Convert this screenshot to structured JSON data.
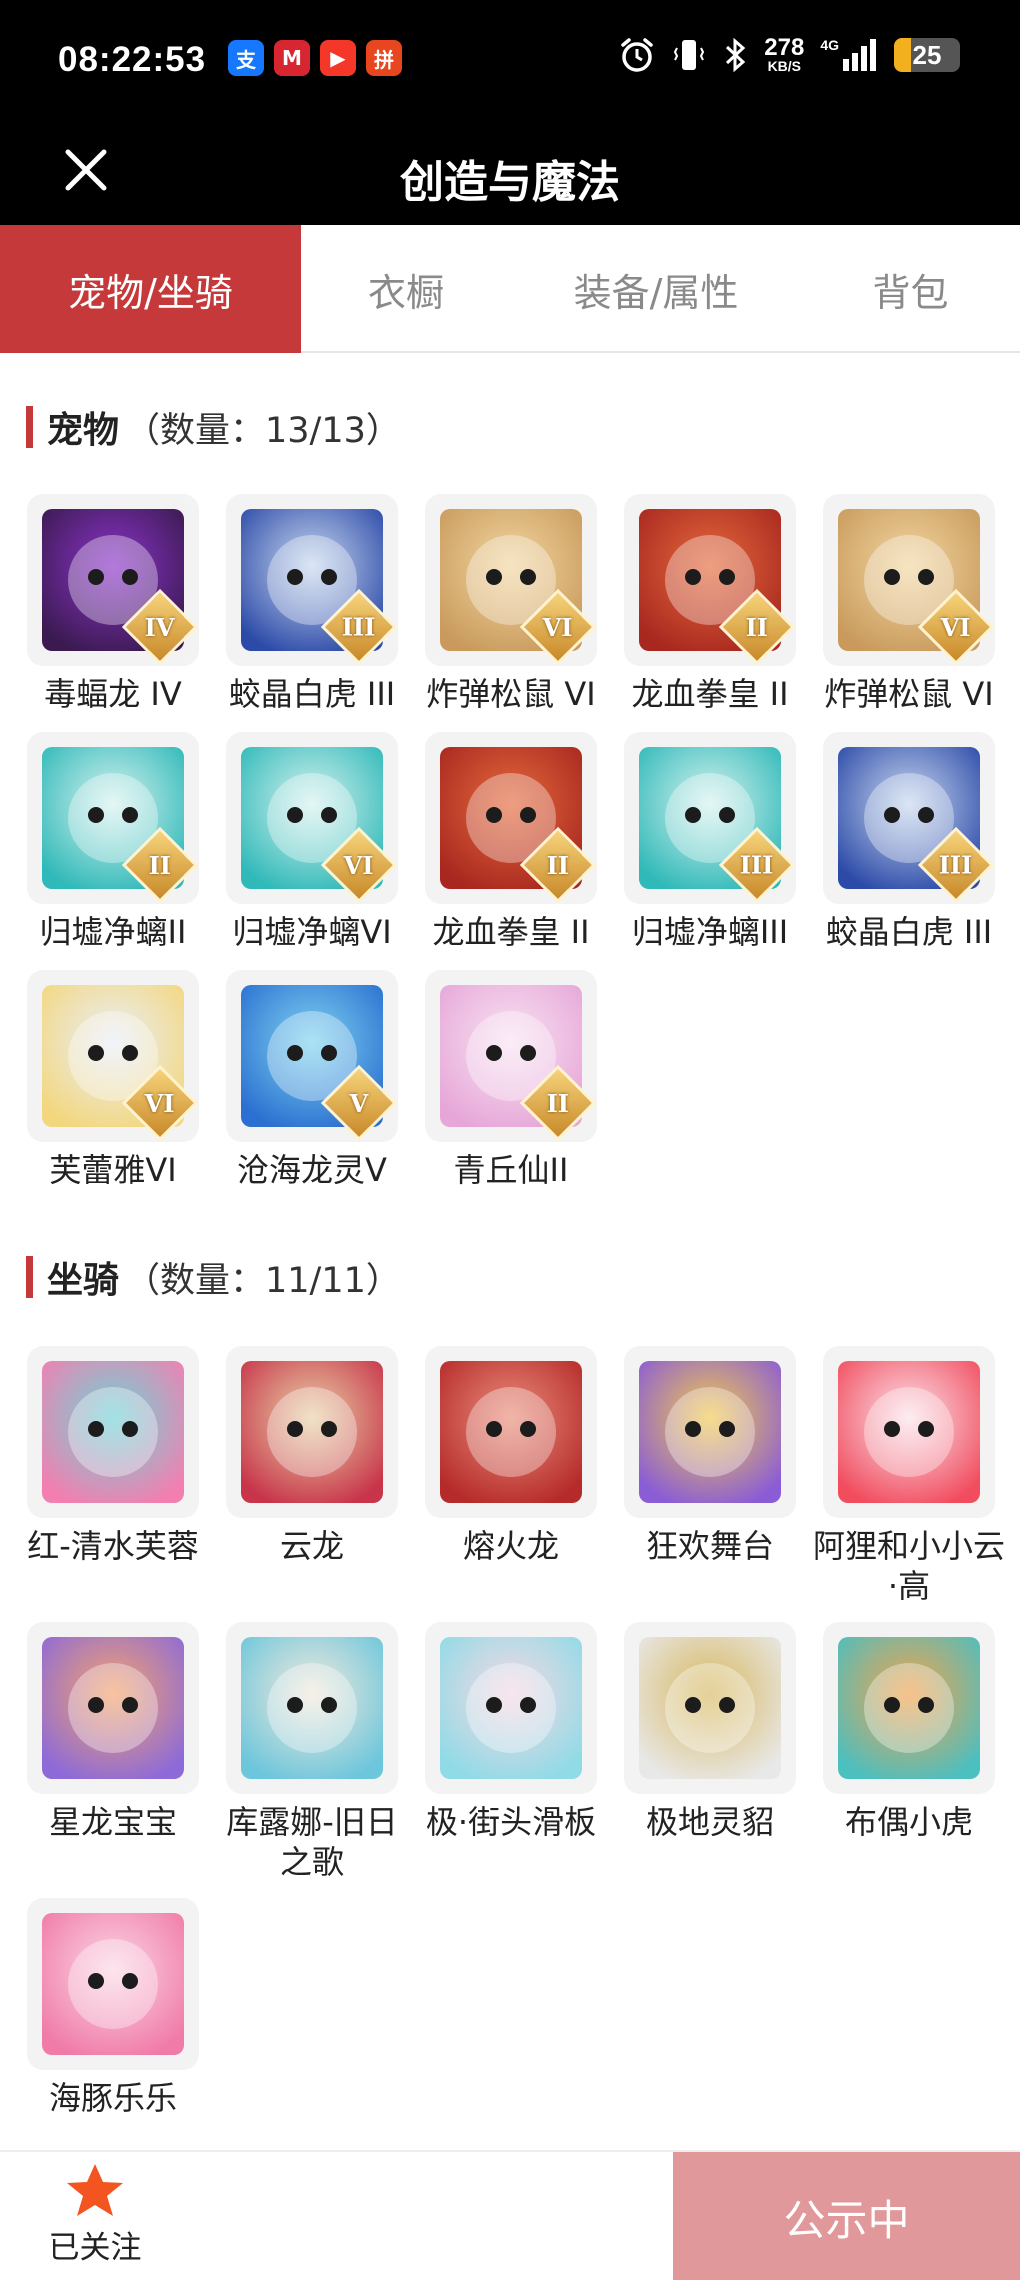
{
  "status_bar": {
    "time": "08:22:53",
    "notification_icons": [
      {
        "name": "alipay-icon",
        "glyph": "支",
        "color": "#1677ff"
      },
      {
        "name": "cmb-bank-icon",
        "glyph": "M",
        "color": "#d7262f"
      },
      {
        "name": "video-play-icon",
        "glyph": "▶",
        "color": "#f5372a"
      },
      {
        "name": "pinduoduo-icon",
        "glyph": "拼",
        "color": "#e8461e"
      }
    ],
    "net_speed_value": "278",
    "net_speed_unit": "KB/S",
    "network_type": "4G",
    "battery_level": "25",
    "battery_fraction": 0.25
  },
  "header": {
    "title": "创造与魔法"
  },
  "tabs": [
    {
      "label": "宠物/坐骑",
      "active": true
    },
    {
      "label": "衣橱",
      "active": false
    },
    {
      "label": "装备/属性",
      "active": false
    },
    {
      "label": "背包",
      "active": false
    }
  ],
  "pets_section": {
    "title": "宠物",
    "count_text": "（数量：13/13）",
    "items": [
      {
        "name": "毒蝠龙 IV",
        "rank": "IV",
        "colors": [
          "#3a1a4f",
          "#8a33c9"
        ]
      },
      {
        "name": "蛟晶白虎 III",
        "rank": "III",
        "colors": [
          "#2c4aa8",
          "#c8d8ef"
        ]
      },
      {
        "name": "炸弹松鼠 VI",
        "rank": "VI",
        "colors": [
          "#c99a5c",
          "#f1d6a0"
        ]
      },
      {
        "name": "龙血拳皇 II",
        "rank": "II",
        "colors": [
          "#a8271f",
          "#e46a3c"
        ]
      },
      {
        "name": "炸弹松鼠 VI",
        "rank": "VI",
        "colors": [
          "#c99a5c",
          "#f1d6a0"
        ]
      },
      {
        "name": "归墟净螭II",
        "rank": "II",
        "colors": [
          "#2fb9b8",
          "#d6f2ef"
        ]
      },
      {
        "name": "归墟净螭VI",
        "rank": "VI",
        "colors": [
          "#2fb9b8",
          "#d6f2ef"
        ]
      },
      {
        "name": "龙血拳皇 II",
        "rank": "II",
        "colors": [
          "#a8271f",
          "#e46a3c"
        ]
      },
      {
        "name": "归墟净螭III",
        "rank": "III",
        "colors": [
          "#2fb9b8",
          "#d6f2ef"
        ]
      },
      {
        "name": "蛟晶白虎 III",
        "rank": "III",
        "colors": [
          "#2c4aa8",
          "#c8d8ef"
        ]
      },
      {
        "name": "芙蕾雅VI",
        "rank": "VI",
        "colors": [
          "#f3d77e",
          "#e9eef7"
        ]
      },
      {
        "name": "沧海龙灵V",
        "rank": "V",
        "colors": [
          "#2a6fd1",
          "#7fd3ef"
        ]
      },
      {
        "name": "青丘仙II",
        "rank": "II",
        "colors": [
          "#e6a6d8",
          "#f8e3f2"
        ]
      }
    ]
  },
  "mounts_section": {
    "title": "坐骑",
    "count_text": "（数量：11/11）",
    "items": [
      {
        "name": "红-清水芙蓉",
        "colors": [
          "#f27fb0",
          "#6fd3d6"
        ]
      },
      {
        "name": "云龙",
        "colors": [
          "#c8344a",
          "#e8d2a6"
        ]
      },
      {
        "name": "熔火龙",
        "colors": [
          "#b52a2a",
          "#e98d7a"
        ]
      },
      {
        "name": "狂欢舞台",
        "colors": [
          "#8a5cd6",
          "#f1c94f"
        ]
      },
      {
        "name": "阿狸和小小云·高",
        "colors": [
          "#f14d5f",
          "#fbe3ea"
        ]
      },
      {
        "name": "星龙宝宝",
        "colors": [
          "#8d6ad8",
          "#f4a36c"
        ]
      },
      {
        "name": "库露娜-旧日之歌",
        "colors": [
          "#6cc6dc",
          "#f3e9dc"
        ]
      },
      {
        "name": "极·街头滑板",
        "colors": [
          "#8fdbe6",
          "#f6d8e4"
        ]
      },
      {
        "name": "极地灵貂",
        "colors": [
          "#e8e8e8",
          "#d7b85f"
        ]
      },
      {
        "name": "布偶小虎",
        "colors": [
          "#4cbfbf",
          "#f4a24c"
        ]
      },
      {
        "name": "海豚乐乐",
        "colors": [
          "#f07aa8",
          "#fbd6e4"
        ]
      }
    ]
  },
  "bottom_bar": {
    "follow_label": "已关注",
    "status_button": "公示中"
  }
}
